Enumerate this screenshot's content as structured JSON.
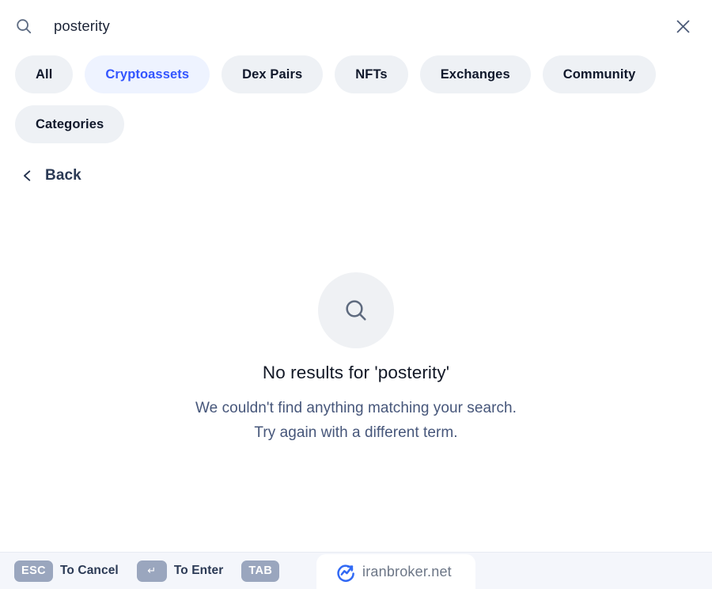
{
  "search": {
    "icon": "search-icon",
    "value": "posterity",
    "placeholder": "Search",
    "close_icon": "close-icon"
  },
  "filters": {
    "items": [
      {
        "label": "All",
        "selected": false
      },
      {
        "label": "Cryptoassets",
        "selected": true
      },
      {
        "label": "Dex Pairs",
        "selected": false
      },
      {
        "label": "NFTs",
        "selected": false
      },
      {
        "label": "Exchanges",
        "selected": false
      },
      {
        "label": "Community",
        "selected": false
      },
      {
        "label": "Categories",
        "selected": false
      }
    ],
    "selected_color": "#3355ff",
    "selected_bg": "#eef3ff",
    "chip_bg": "#eef1f5"
  },
  "navigation": {
    "back_label": "Back",
    "back_icon": "chevron-left-icon"
  },
  "empty_state": {
    "icon": "search-icon",
    "title": "No results for 'posterity'",
    "description_line1": "We couldn't find anything matching your search.",
    "description_line2": "Try again with a different term."
  },
  "footer": {
    "shortcuts": [
      {
        "key": "ESC",
        "label": "To Cancel"
      },
      {
        "key": "↵",
        "label": "To Enter"
      },
      {
        "key": "TAB",
        "label": ""
      }
    ],
    "keycap_bg": "#9aa6be"
  },
  "watermark": {
    "text": "iranbroker.net",
    "logo_icon": "chart-arrow-logo-icon"
  }
}
